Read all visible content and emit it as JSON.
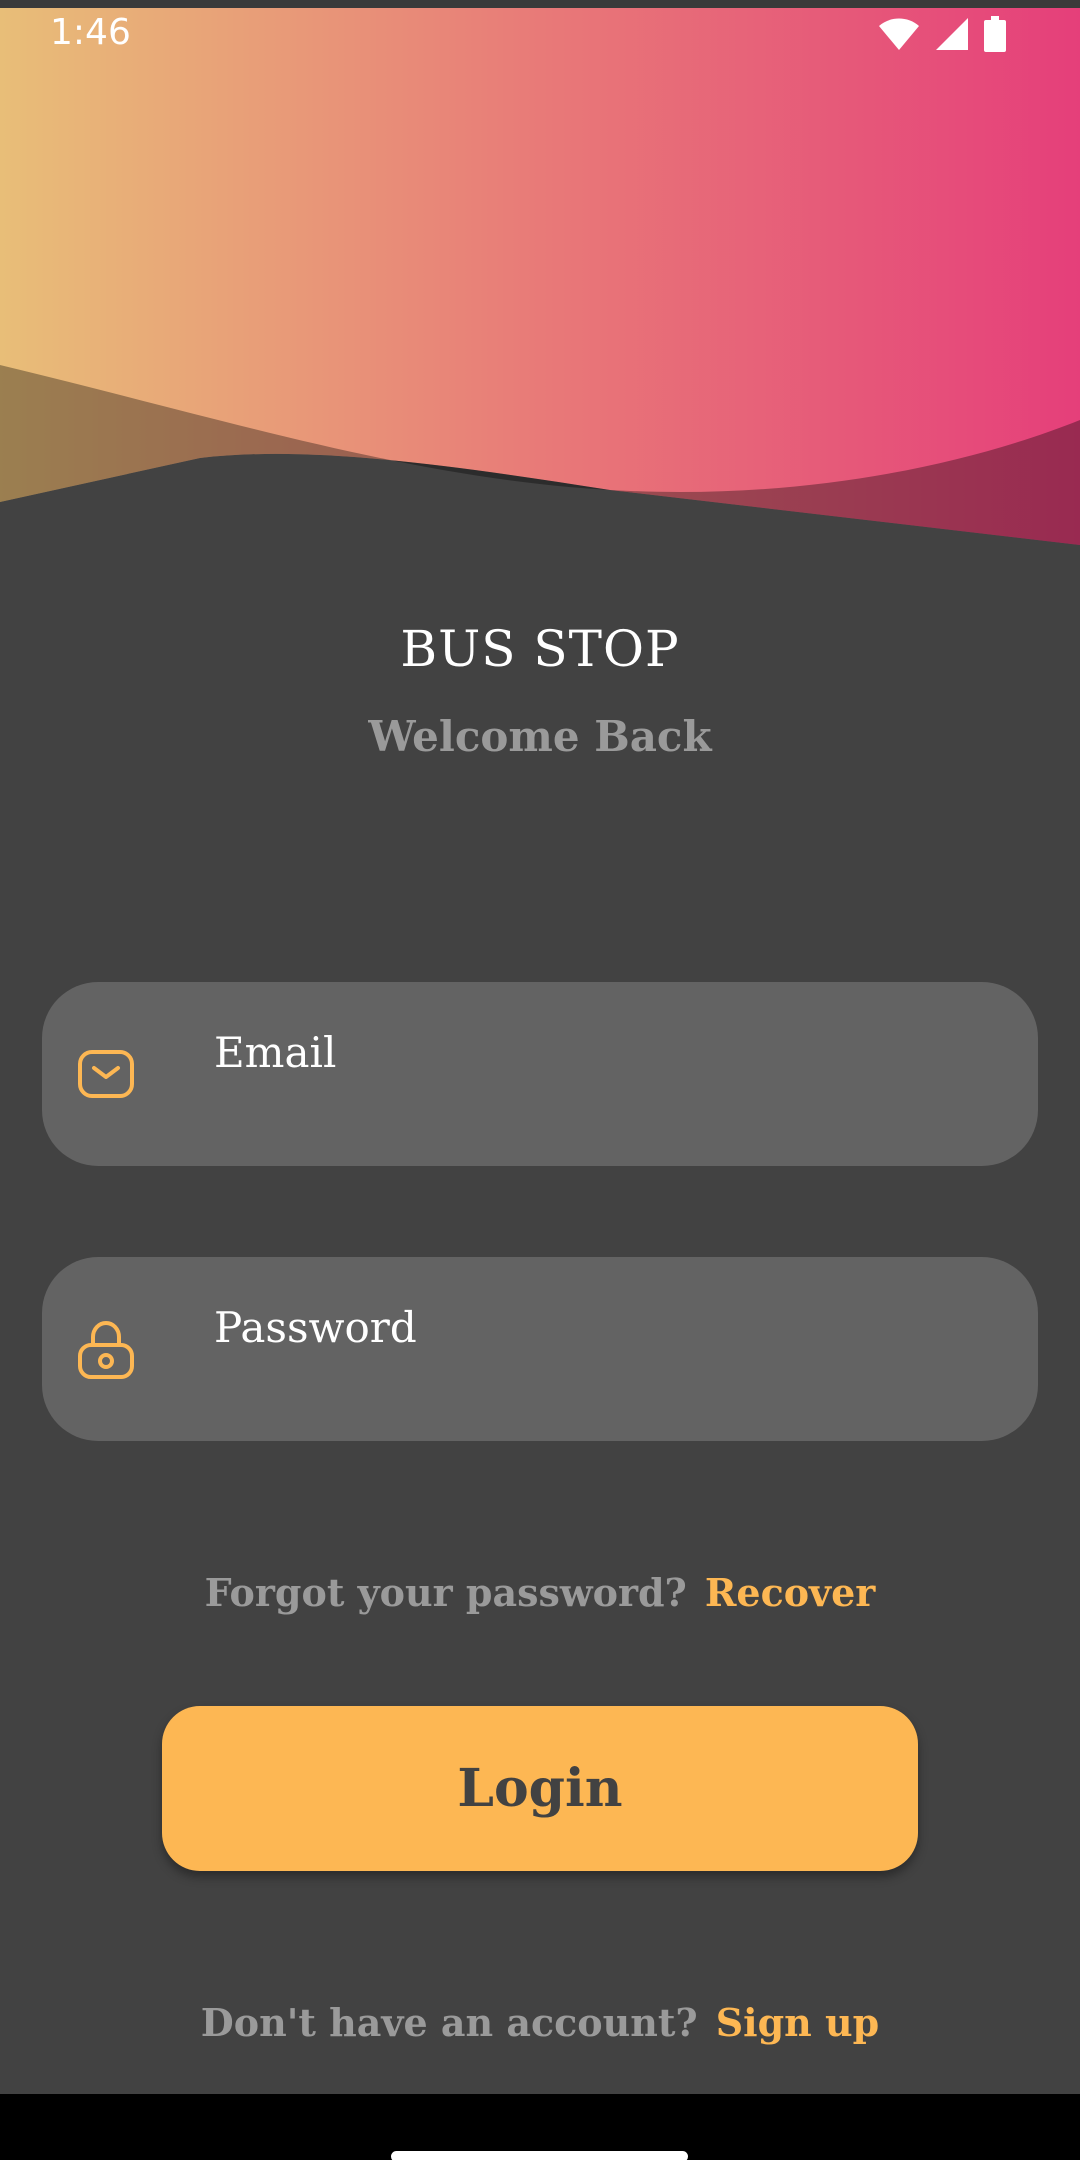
{
  "status_bar": {
    "time": "1:46",
    "icons": [
      "wifi-icon",
      "cellular-signal-icon",
      "battery-icon"
    ]
  },
  "app": {
    "title": "BUS STOP",
    "subtitle": "Welcome Back"
  },
  "form": {
    "email": {
      "placeholder": "Email",
      "value": "",
      "icon": "envelope-icon"
    },
    "password": {
      "placeholder": "Password",
      "value": "",
      "icon": "lock-icon"
    }
  },
  "forgot": {
    "prompt": "Forgot your password?",
    "link": "Recover"
  },
  "login_button": "Login",
  "signup": {
    "prompt": "Don't have an account?",
    "link": "Sign up"
  },
  "colors": {
    "background": "#424242",
    "field": "#636363",
    "accent": "#FDB753",
    "gradient_start": "#E8BE78",
    "gradient_end": "#E53F7A",
    "muted_text": "#9A9A9A"
  }
}
